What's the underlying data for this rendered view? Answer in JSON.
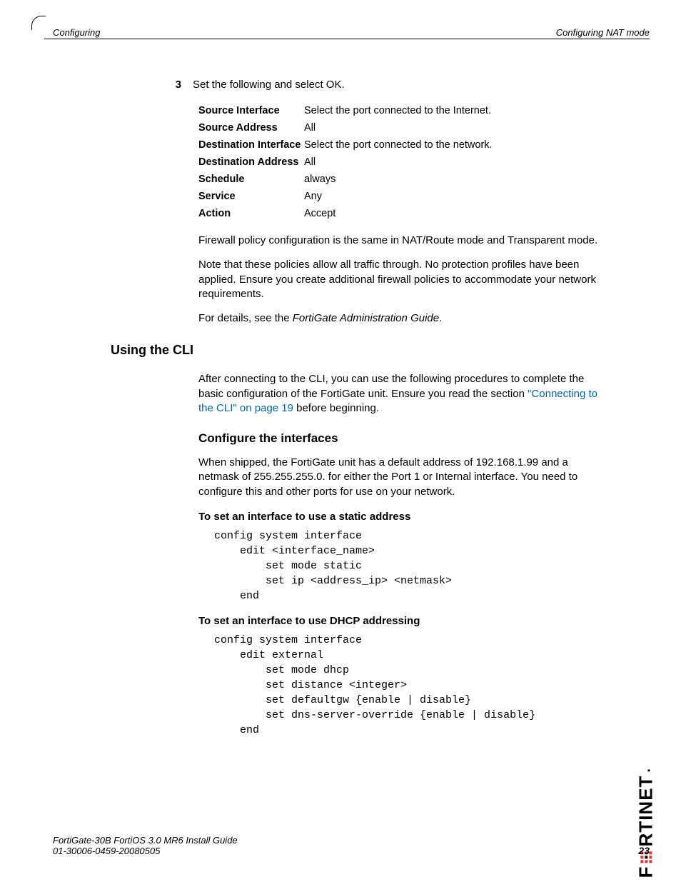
{
  "header": {
    "left": "Configuring",
    "right": "Configuring NAT mode"
  },
  "step": {
    "num": "3",
    "text": "Set the following and select OK."
  },
  "params": [
    {
      "key": "Source Interface",
      "val": "Select the port connected to the Internet."
    },
    {
      "key": "Source Address",
      "val": "All"
    },
    {
      "key": "Destination Interface",
      "val": "Select the port connected to the network."
    },
    {
      "key": "Destination Address",
      "val": "All"
    },
    {
      "key": "Schedule",
      "val": "always"
    },
    {
      "key": "Service",
      "val": "Any"
    },
    {
      "key": "Action",
      "val": "Accept"
    }
  ],
  "p_firewall": "Firewall policy configuration is the same in NAT/Route mode and Transparent mode.",
  "p_note": "Note that these policies allow all traffic through. No protection profiles have been applied. Ensure you create additional firewall policies to accommodate your network requirements.",
  "p_details_pre": "For details, see the ",
  "p_details_ital": "FortiGate Administration Guide",
  "p_details_post": ".",
  "h2_cli": "Using the CLI",
  "p_cli_pre": "After connecting to the CLI, you can use the following procedures to complete the basic configuration of the FortiGate unit. Ensure you read the section ",
  "p_cli_link": "\"Connecting to the CLI\" on page 19",
  "p_cli_post": " before beginning.",
  "h3_conf": "Configure the interfaces",
  "p_conf": "When shipped, the FortiGate unit has a default address of 192.168.1.99 and a netmask of 255.255.255.0. for either the Port 1 or Internal interface. You need to configure this and other ports for use on your network.",
  "h4_static": "To set an interface to use a static address",
  "code_static": "config system interface\n    edit <interface_name>\n        set mode static\n        set ip <address_ip> <netmask>\n    end",
  "h4_dhcp": "To set an interface to use DHCP addressing",
  "code_dhcp": "config system interface\n    edit external\n        set mode dhcp\n        set distance <integer>\n        set defaultgw {enable | disable}\n        set dns-server-override {enable | disable}\n    end",
  "footer": {
    "line1": "FortiGate-30B FortiOS 3.0 MR6 Install Guide",
    "line2": "01-30006-0459-20080505",
    "page": "23"
  },
  "logo": {
    "text_pre": "F",
    "text_post": "RTINET",
    "dot": "."
  }
}
